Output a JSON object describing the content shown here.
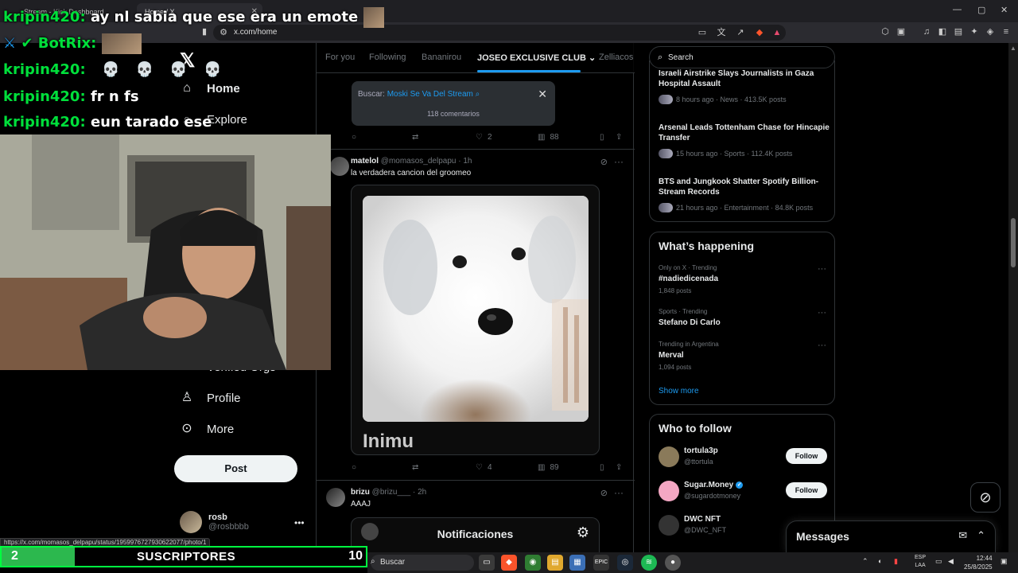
{
  "browser": {
    "tabs": [
      {
        "title": "Stream - Kick Dashboard"
      },
      {
        "title": "Home / X"
      }
    ],
    "url": "x.com/home",
    "status_url": "https://x.com/momasos_delpapu/status/1959976727930622077/photo/1"
  },
  "nav": {
    "items": [
      {
        "label": "Home",
        "icon": "home-icon"
      },
      {
        "label": "Explore",
        "icon": "search-icon"
      },
      {
        "label": "Verified Orgs",
        "icon": "lightning-icon"
      },
      {
        "label": "Profile",
        "icon": "person-icon"
      },
      {
        "label": "More",
        "icon": "more-circle-icon"
      }
    ],
    "post_label": "Post",
    "account": {
      "name": "rosb",
      "handle": "@rosbbbb"
    }
  },
  "feed_tabs": [
    "For you",
    "Following",
    "Bananirou",
    "JOSEO EXCLUSIVE CLUB",
    "Zelliacos"
  ],
  "search_popup": {
    "prefix": "Buscar:",
    "query": "Moski Se Va Del Stream",
    "comments": "118 comentarios"
  },
  "tweets": [
    {
      "replies": "",
      "retweets": "",
      "likes": "2",
      "views": "88"
    },
    {
      "name": "matelol",
      "handle": "@momasos_delpapu",
      "time": "· 1h",
      "text": "la verdadera cancion del groomeo",
      "media_caption": "Inimu",
      "replies": "",
      "retweets": "",
      "likes": "4",
      "views": "89"
    },
    {
      "name": "brizu",
      "handle": "@brizu___",
      "time": "· 2h",
      "text": "AAAJ",
      "embed_title": "Notificaciones"
    }
  ],
  "right": {
    "search_placeholder": "Search",
    "news": [
      {
        "title": "Israeli Airstrike Slays Journalists in Gaza Hospital Assault",
        "meta": "8 hours ago · News · 413.5K posts"
      },
      {
        "title": "Arsenal Leads Tottenham Chase for Hincapie Transfer",
        "meta": "15 hours ago · Sports · 112.4K posts"
      },
      {
        "title": "BTS and Jungkook Shatter Spotify Billion-Stream Records",
        "meta": "21 hours ago · Entertainment · 84.8K posts"
      }
    ],
    "happening_title": "What’s happening",
    "trends": [
      {
        "context": "Only on X · Trending",
        "name": "#nadiedicenada",
        "count": "1,848 posts"
      },
      {
        "context": "Sports · Trending",
        "name": "Stefano Di Carlo",
        "count": ""
      },
      {
        "context": "Trending in Argentina",
        "name": "Merval",
        "count": "1,094 posts"
      }
    ],
    "show_more": "Show more",
    "who_to_follow_title": "Who to follow",
    "follow": [
      {
        "name": "tortula3p",
        "handle": "@ttortula",
        "button": "Follow",
        "verified": false,
        "color": "#8a7a5a"
      },
      {
        "name": "Sugar.Money",
        "handle": "@sugardotmoney",
        "button": "Follow",
        "verified": true,
        "color": "#f4a7c3"
      },
      {
        "name": "DWC NFT",
        "handle": "@DWC_NFT",
        "button": "",
        "verified": false,
        "color": "#333333"
      }
    ],
    "messages_title": "Messages"
  },
  "stream_overlay": {
    "chat": [
      {
        "user": "kripin420:",
        "msg": "ay nl sabia que ese era un emote"
      },
      {
        "user": "BotRix:",
        "msg": ""
      },
      {
        "user": "kripin420:",
        "msg": ""
      },
      {
        "user": "kripin420:",
        "msg": "fr n fs"
      },
      {
        "user": "kripin420:",
        "msg": "eun tarado ese"
      }
    ],
    "subs_current": "2",
    "subs_label": "SUSCRIPTORES",
    "subs_goal": "10",
    "subs_progress": 0.2
  },
  "taskbar": {
    "search_label": "Buscar",
    "lang": "ESP",
    "layout": "LAA",
    "time": "12:44",
    "date": "25/8/2025"
  },
  "colors": {
    "accent": "#1d9bf0",
    "green": "#00e03b",
    "bg": "#000000"
  }
}
